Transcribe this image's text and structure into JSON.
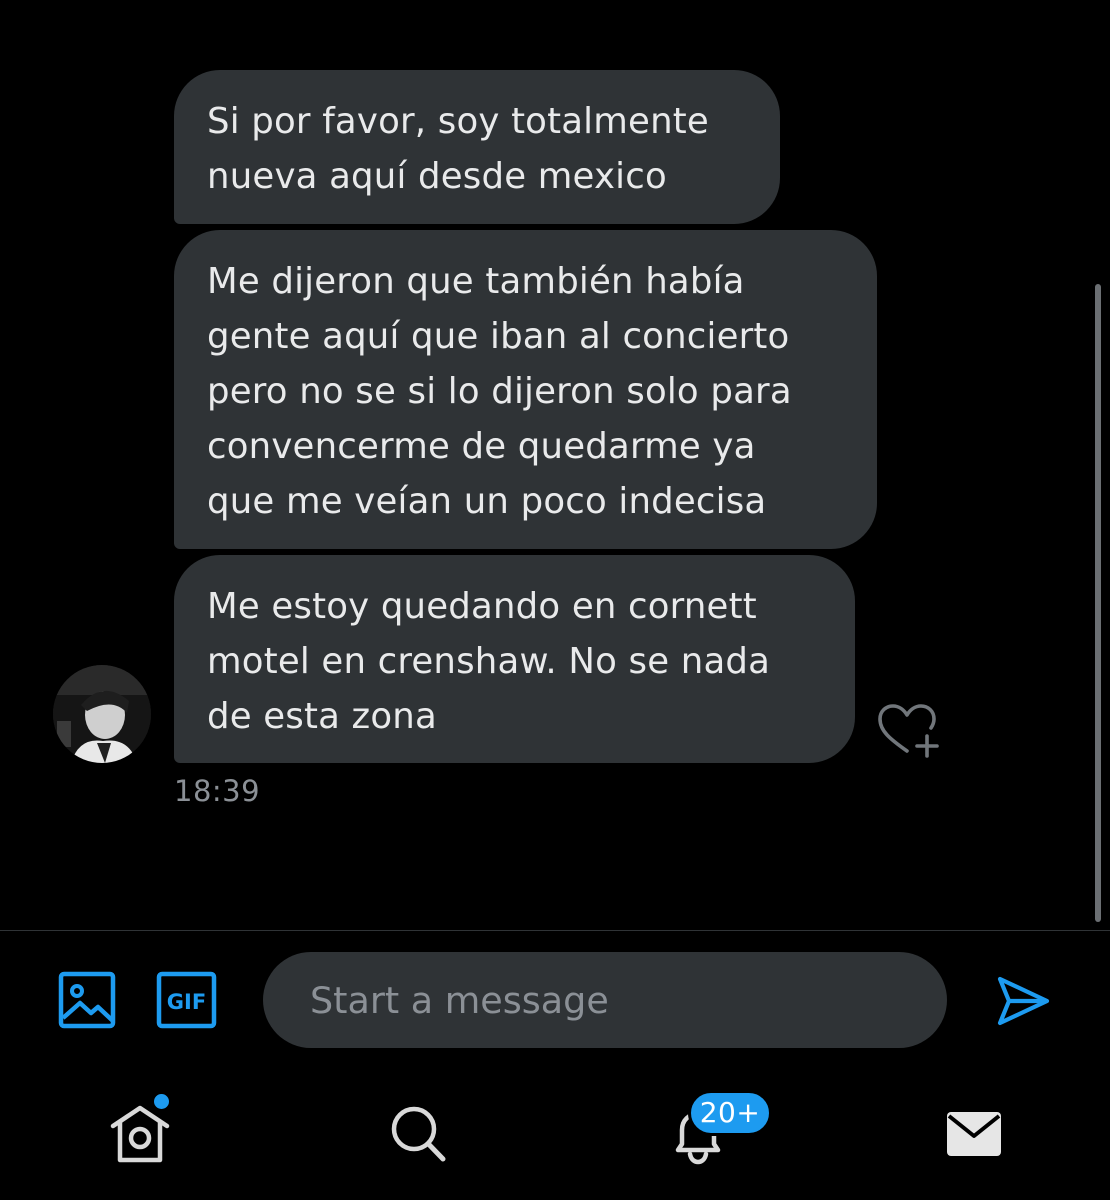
{
  "conversation": {
    "messages": [
      {
        "lines": [
          "Si por favor, soy totalmente",
          "nueva aquí desde mexico"
        ]
      },
      {
        "lines": [
          "Me dijeron que también había",
          "gente aquí que iban al concierto",
          "pero no se si lo dijeron solo para",
          "convencerme de quedarme ya",
          "que me veían un poco indecisa"
        ]
      },
      {
        "lines": [
          "Me estoy quedando en cornett",
          "motel en crenshaw. No se nada",
          "de esta zona"
        ]
      }
    ],
    "timestamp": "18:39"
  },
  "composer": {
    "placeholder": "Start a message",
    "media_icon": "image-icon",
    "gif_label": "GIF",
    "send_icon": "send-icon"
  },
  "tab_bar": {
    "home_icon": "home-icon",
    "search_icon": "search-icon",
    "notifications_icon": "bell-icon",
    "notifications_badge": "20+",
    "messages_icon": "envelope-icon"
  },
  "colors": {
    "background": "#000000",
    "bubble": "#2f3336",
    "accent": "#1d9bf0",
    "muted_text": "#8b9096"
  }
}
